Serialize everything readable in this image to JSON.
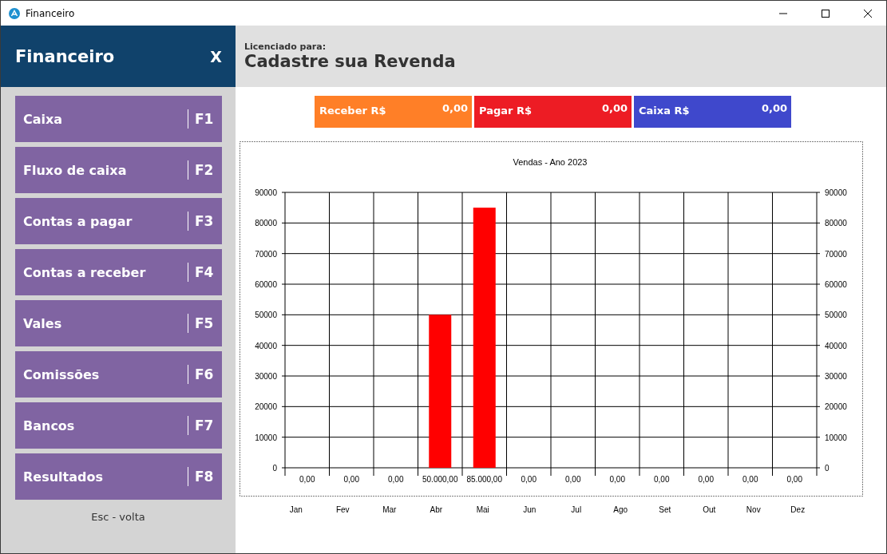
{
  "window": {
    "title": "Financeiro"
  },
  "sidebar": {
    "title": "Financeiro",
    "close": "X",
    "items": [
      {
        "label": "Caixa",
        "key": "F1"
      },
      {
        "label": "Fluxo de caixa",
        "key": "F2"
      },
      {
        "label": "Contas a pagar",
        "key": "F3"
      },
      {
        "label": "Contas a receber",
        "key": "F4"
      },
      {
        "label": "Vales",
        "key": "F5"
      },
      {
        "label": "Comissões",
        "key": "F6"
      },
      {
        "label": "Bancos",
        "key": "F7"
      },
      {
        "label": "Resultados",
        "key": "F8"
      }
    ],
    "footer": "Esc - volta"
  },
  "header": {
    "caption": "Licenciado para:",
    "name": "Cadastre sua Revenda"
  },
  "totals": [
    {
      "label": "Receber R$",
      "value": "0,00",
      "color": "#ff7f27"
    },
    {
      "label": "Pagar R$",
      "value": "0,00",
      "color": "#ed1c24"
    },
    {
      "label": "Caixa R$",
      "value": "0,00",
      "color": "#3f48cc"
    }
  ],
  "chart_data": {
    "type": "bar",
    "title": "Vendas - Ano 2023",
    "categories": [
      "Jan",
      "Fev",
      "Mar",
      "Abr",
      "Mai",
      "Jun",
      "Jul",
      "Ago",
      "Set",
      "Out",
      "Nov",
      "Dez"
    ],
    "series": [
      {
        "color": "#ff0000",
        "values": [
          0,
          0,
          0,
          50000,
          85000,
          0,
          0,
          0,
          0,
          0,
          0,
          0
        ]
      }
    ],
    "ylim": [
      0,
      90000
    ],
    "yticks": [
      0,
      10000,
      20000,
      30000,
      40000,
      50000,
      60000,
      70000,
      80000,
      90000
    ],
    "grid": true,
    "value_labels": [
      "0,00",
      "0,00",
      "0,00",
      "50.000,00",
      "85.000,00",
      "0,00",
      "0,00",
      "0,00",
      "0,00",
      "0,00",
      "0,00",
      "0,00"
    ]
  },
  "right_axis_labels": [
    "90000",
    "80000",
    "70000",
    "60000",
    "50000",
    "40000",
    "30000",
    "20000",
    "10000",
    "0"
  ]
}
